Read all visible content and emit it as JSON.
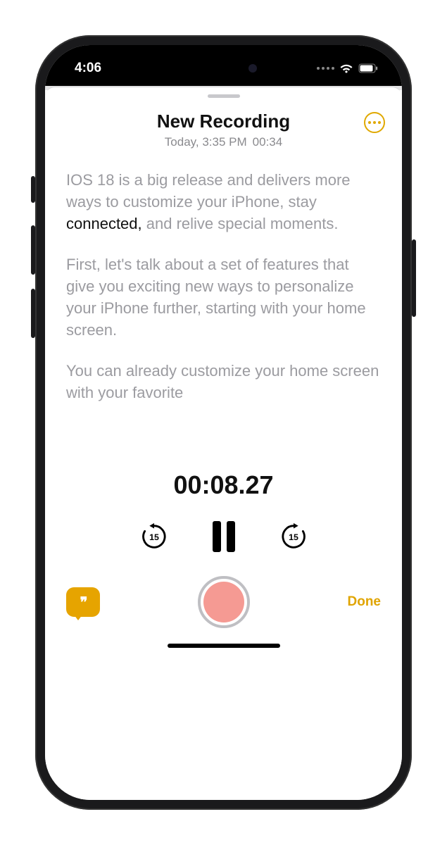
{
  "status": {
    "time": "4:06"
  },
  "header": {
    "title": "New Recording",
    "date": "Today, 3:35 PM",
    "duration": "00:34"
  },
  "transcript": {
    "p1_pre": "IOS 18 is a big release and delivers more ways to customize your iPhone, stay ",
    "p1_hl": "connected,",
    "p1_post": " and relive special moments.",
    "p2": "First, let's talk about a set of features that give you exciting new ways to personalize your iPhone further, starting with your home screen.",
    "p3": "You can already customize your home screen with your favorite"
  },
  "playback": {
    "elapsed": "00:08.27",
    "skip_back_seconds": "15",
    "skip_fwd_seconds": "15"
  },
  "actions": {
    "done_label": "Done"
  }
}
